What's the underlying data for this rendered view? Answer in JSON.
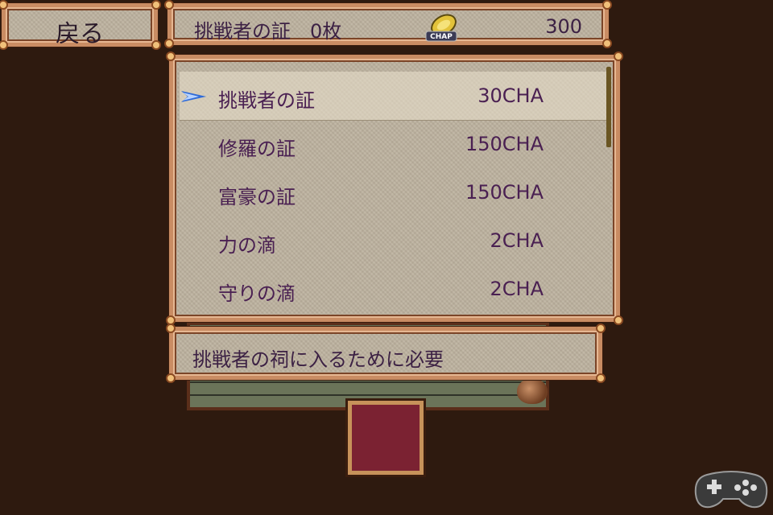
{
  "back_button": {
    "label": "戻る"
  },
  "header": {
    "label": "挑戦者の証　0枚",
    "coin_icon": "chap-coin-icon",
    "coin_text": "CHAP",
    "value": "300"
  },
  "shop": {
    "items": [
      {
        "name": "挑戦者の証",
        "price": "30CHA",
        "selected": true
      },
      {
        "name": "修羅の証",
        "price": "150CHA"
      },
      {
        "name": "富豪の証",
        "price": "150CHA"
      },
      {
        "name": "力の滴",
        "price": "2CHA"
      },
      {
        "name": "守りの滴",
        "price": "2CHA"
      }
    ]
  },
  "description": {
    "text": "挑戦者の祠に入るために必要"
  },
  "colors": {
    "background": "#2e1a0f",
    "panel": "#bdb29f",
    "frame": "#c98c63",
    "text": "#4a2052",
    "cursor": "#2f6bd8",
    "carpet": "#7b2232"
  },
  "icons": {
    "cursor": "selection-cursor-icon",
    "gamepad": "gamepad-icon"
  }
}
